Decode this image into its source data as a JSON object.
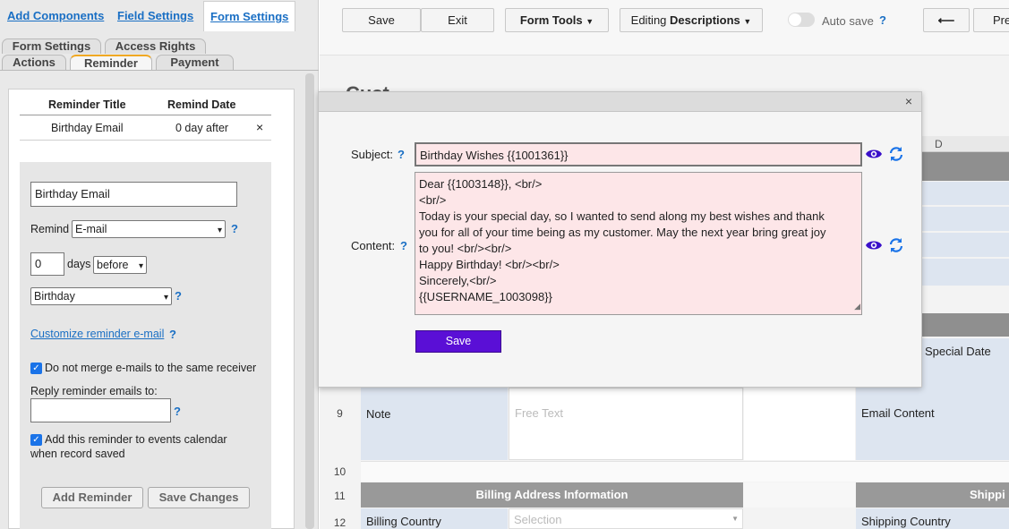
{
  "top_tabs": {
    "add_components": "Add Components",
    "field_settings": "Field Settings",
    "form_settings": "Form Settings"
  },
  "sub_tabs": {
    "form_settings": "Form Settings",
    "access_rights": "Access Rights",
    "actions": "Actions",
    "reminder": "Reminder",
    "payment": "Payment"
  },
  "reminder_table": {
    "headers": [
      "Reminder Title",
      "Remind Date"
    ],
    "rows": [
      {
        "title": "Birthday Email",
        "date": "0 day after",
        "remove": "×"
      }
    ]
  },
  "reminder_form": {
    "title_value": "Birthday Email",
    "remind_label": "Remind",
    "remind_type": "E-mail",
    "days_value": "0",
    "days_label": "days",
    "before_after": "before",
    "date_field": "Birthday",
    "customize_link": "Customize reminder e-mail",
    "help": "?",
    "no_merge_label": "Do not merge e-mails to the same receiver",
    "reply_label": "Reply reminder emails to:",
    "reply_value": "",
    "calendar_label_1": "Add this reminder to events calendar",
    "calendar_label_2": "when record saved",
    "add_button": "Add Reminder",
    "save_button": "Save Changes"
  },
  "toolbar": {
    "save": "Save",
    "exit": "Exit",
    "form_tools": "Form Tools",
    "editing_prefix": "Editing",
    "editing_value": "Descriptions",
    "auto_save": "Auto save",
    "help": "?",
    "back_arrow": "⟵",
    "preview": "Pre"
  },
  "sheet": {
    "partial_title": "Cust",
    "col_d": "D",
    "special_date": "Special Date",
    "rows": [
      {
        "num": "9",
        "b": "Note",
        "c": "Free Text",
        "e": "Email Content"
      },
      {
        "num": "10",
        "b": "",
        "c": "",
        "e": ""
      },
      {
        "num": "11",
        "b": "Billing Address Information",
        "c": "",
        "e": "Shippi"
      },
      {
        "num": "12",
        "b": "Billing Country",
        "c": "Selection",
        "e": "Shipping Country"
      }
    ]
  },
  "dialog": {
    "close": "×",
    "subject_label": "Subject:",
    "help": "?",
    "subject_value": "Birthday Wishes {{1001361}}",
    "content_label": "Content:",
    "content_lines": [
      "Dear {{1003148}}, <br/>",
      "<br/>",
      "Today is your special day, so I wanted to send along my best wishes and thank",
      "you for all of your time being as my customer. May the next year bring great joy",
      "to you! <br/><br/>",
      "Happy Birthday! <br/><br/>",
      "Sincerely,<br/>",
      "{{USERNAME_1003098}}"
    ],
    "save": "Save"
  },
  "colors": {
    "link": "#1a6fc4",
    "primary_button": "#5a0fd6",
    "pink_field": "#fde6e8",
    "icon": "#3a10c9",
    "refresh": "#1a73e8"
  }
}
